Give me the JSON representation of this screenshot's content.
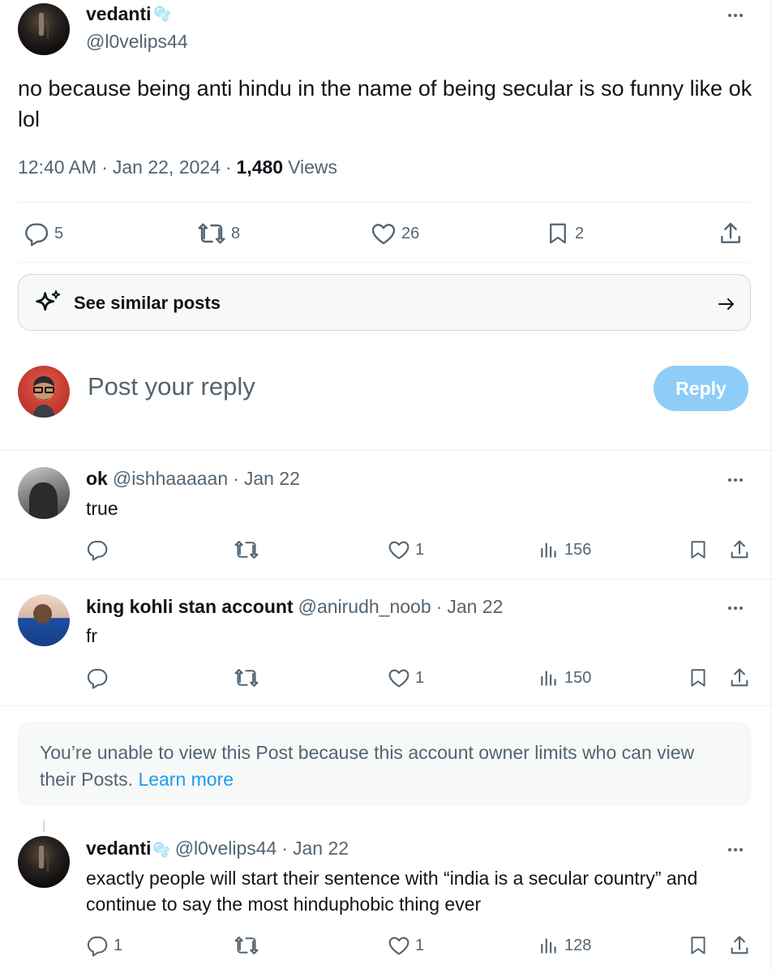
{
  "main_post": {
    "display_name": "vedanti",
    "name_emoji": "🫧",
    "handle": "@l0velips44",
    "text": "no because being anti hindu in the name of being secular is so funny like ok lol",
    "time": "12:40 AM",
    "date": "Jan 22, 2024",
    "views_count": "1,480",
    "views_label": "Views",
    "stats": {
      "replies": "5",
      "reposts": "8",
      "likes": "26",
      "bookmarks": "2"
    }
  },
  "similar_posts": {
    "label": "See similar posts"
  },
  "composer": {
    "placeholder": "Post your reply",
    "button_label": "Reply"
  },
  "replies": [
    {
      "display_name": "ok",
      "handle": "@ishhaaaaan",
      "date": "Jan 22",
      "text": "true",
      "replies": "",
      "likes": "1",
      "views": "156"
    },
    {
      "display_name": "king kohli stan account",
      "handle": "@anirudh_noob",
      "date": "Jan 22",
      "text": "fr",
      "replies": "",
      "likes": "1",
      "views": "150"
    },
    {
      "display_name": "vedanti",
      "name_emoji": "🫧",
      "handle": "@l0velips44",
      "date": "Jan 22",
      "text": "exactly people will start their sentence with “india is a secular country” and continue to say the most hinduphobic thing ever",
      "replies": "1",
      "likes": "1",
      "views": "128"
    }
  ],
  "restricted_notice": {
    "text": "You’re unable to view this Post because this account owner limits who can view their Posts.",
    "link": "Learn more"
  },
  "icons": [
    "more-icon",
    "reply-icon",
    "repost-icon",
    "like-icon",
    "bookmark-icon",
    "share-icon",
    "sparkle-icon",
    "arrow-right-icon",
    "views-icon"
  ],
  "colors": {
    "accent": "#1d9bf0",
    "reply_button": "#8ecdf8",
    "muted_text": "#536471",
    "divider": "#eff3f4"
  }
}
